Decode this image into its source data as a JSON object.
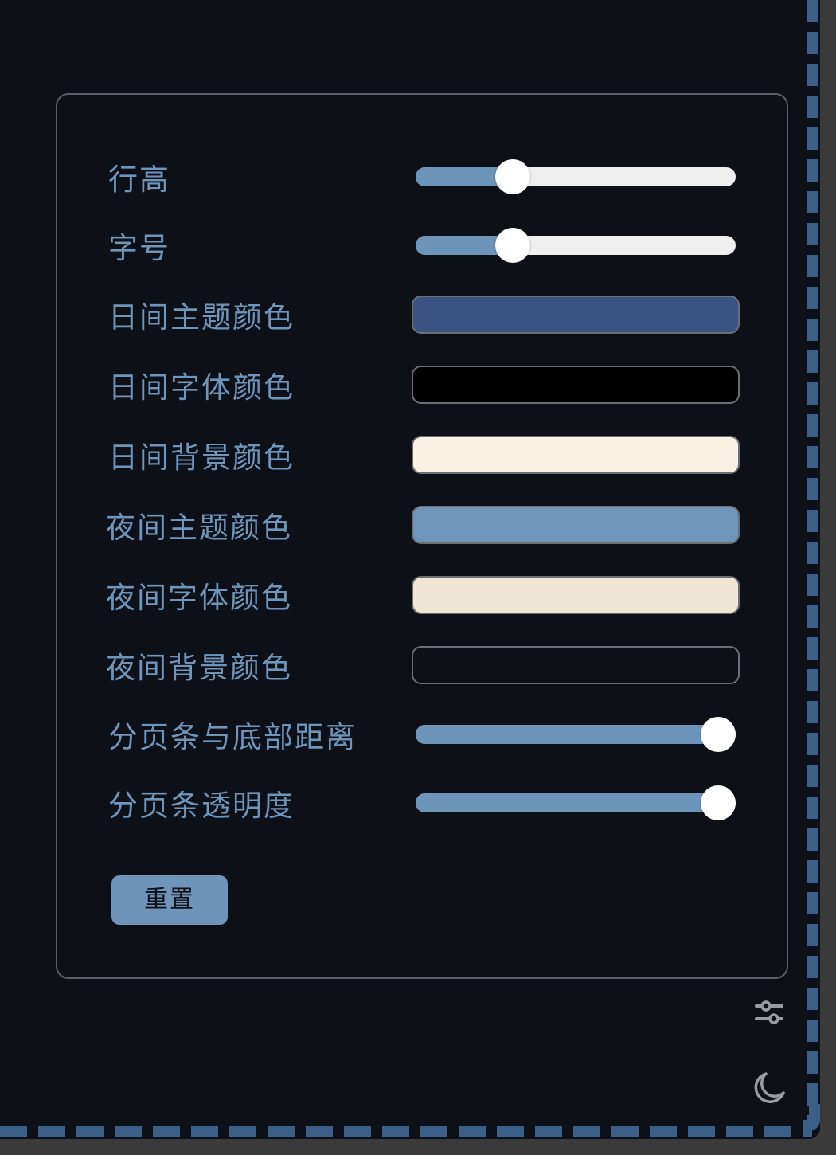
{
  "settings": {
    "line_height": {
      "label": "行高",
      "value": 0.28
    },
    "font_size": {
      "label": "字号",
      "value": 0.28
    },
    "day_theme_color": {
      "label": "日间主题颜色",
      "color": "#3a5383"
    },
    "day_font_color": {
      "label": "日间字体颜色",
      "color": "#000000"
    },
    "day_bg_color": {
      "label": "日间背景颜色",
      "color": "#f9f2e4"
    },
    "night_theme_color": {
      "label": "夜间主题颜色",
      "color": "#6e96bb"
    },
    "night_font_color": {
      "label": "夜间字体颜色",
      "color": "#f0e6d4"
    },
    "night_bg_color": {
      "label": "夜间背景颜色",
      "color": "#0e1018"
    },
    "pager_bottom_distance": {
      "label": "分页条与底部距离",
      "value": 1.0
    },
    "pager_opacity": {
      "label": "分页条透明度",
      "value": 1.0
    },
    "reset_label": "重置"
  },
  "icons": {
    "settings": "sliders-icon",
    "dark_mode": "moon-icon"
  },
  "colors": {
    "accent": "#6e96bb",
    "page_bg": "#0e1018",
    "panel_border": "#5b5e66",
    "icon": "#9a9ca2"
  }
}
